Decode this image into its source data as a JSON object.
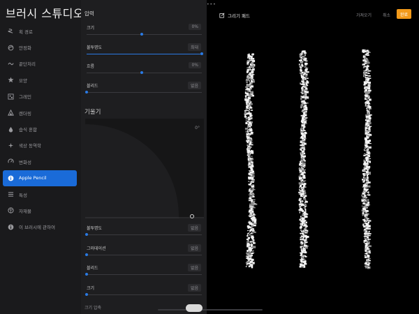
{
  "app_title": "브러시 스튜디오",
  "sidebar": {
    "items": [
      {
        "label": "획 경로",
        "icon": "stroke-path-icon"
      },
      {
        "label": "안정화",
        "icon": "stabilization-icon"
      },
      {
        "label": "끝단처리",
        "icon": "taper-icon"
      },
      {
        "label": "모양",
        "icon": "shape-icon"
      },
      {
        "label": "그레인",
        "icon": "grain-icon"
      },
      {
        "label": "렌더링",
        "icon": "rendering-icon"
      },
      {
        "label": "습식 혼합",
        "icon": "wet-mix-icon"
      },
      {
        "label": "색상 동역학",
        "icon": "color-dynamics-icon"
      },
      {
        "label": "변화성",
        "icon": "dynamics-icon"
      },
      {
        "label": "Apple Pencil",
        "icon": "info-icon",
        "active": true
      },
      {
        "label": "특성",
        "icon": "properties-icon"
      },
      {
        "label": "자재물",
        "icon": "materials-icon"
      },
      {
        "label": "이 브러시에 관하여",
        "icon": "about-icon"
      }
    ]
  },
  "settings": {
    "pressure_header": "압력",
    "pressure_sliders": [
      {
        "label": "크기",
        "value_text": "0%",
        "level": 0.48,
        "filled": false
      },
      {
        "label": "불투명도",
        "value_text": "최대",
        "level": 1.0,
        "filled": true
      },
      {
        "label": "흐름",
        "value_text": "0%",
        "level": 0.48,
        "filled": false
      },
      {
        "label": "블리드",
        "value_text": "없음",
        "level": 0.0,
        "filled": false
      }
    ],
    "tilt_header": "기울기",
    "tilt_angle": "0°",
    "tilt_sliders": [
      {
        "label": "불투명도",
        "value_text": "없음",
        "level": 0.0
      },
      {
        "label": "그러데이션",
        "value_text": "없음",
        "level": 0.0
      },
      {
        "label": "블리드",
        "value_text": "없음",
        "level": 0.0
      },
      {
        "label": "크기",
        "value_text": "없음",
        "level": 0.0
      }
    ],
    "size_compression_label": "크기 압축"
  },
  "topbar": {
    "draw_pad_label": "그리기 패드",
    "import_label": "가져오기",
    "cancel_label": "취소",
    "done_label": "완료"
  },
  "colors": {
    "accent": "#1a6bd8",
    "done": "#f29a1a"
  }
}
